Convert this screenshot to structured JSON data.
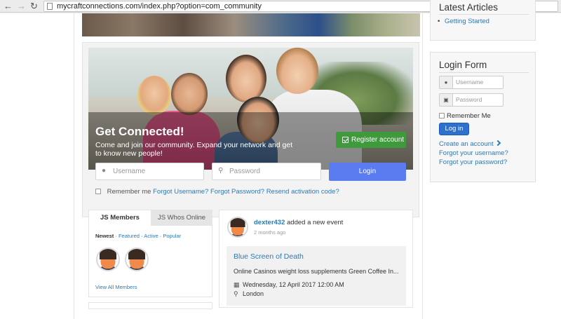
{
  "browser": {
    "url": "mycraftconnections.com/index.php?option=com_community",
    "back_glyph": "←",
    "forward_glyph": "→",
    "reload_glyph": "↻"
  },
  "hero": {
    "title": "Get Connected!",
    "text": "Come and join our community. Expand your network and get to know new people!",
    "register_label": "Register account"
  },
  "login_panel": {
    "username_placeholder": "Username",
    "password_placeholder": "Password",
    "login_label": "Login",
    "remember_label": "Remember me",
    "forgot_username": "Forgot Username?",
    "forgot_password": "Forgot Password?",
    "resend_activation": "Resend activation code?"
  },
  "members_module": {
    "tabs": [
      "JS Members",
      "JS Whos Online"
    ],
    "filters": {
      "newest": "Newest",
      "sep": " · ",
      "featured": "Featured",
      "active": "Active",
      "popular": "Popular"
    },
    "view_all": "View All Members"
  },
  "activity": {
    "user": "dexter432",
    "action": " added a new event",
    "time": "2 months ago",
    "event": {
      "title": "Blue Screen of Death",
      "description": "Online Casinos weight loss supplements Green Coffee In...",
      "date": "Wednesday, 12 April 2017 12:00 AM",
      "location": "London"
    }
  },
  "sidebar": {
    "latest_title": "Latest Articles",
    "latest_items": [
      "Getting Started"
    ],
    "login_form": {
      "title": "Login Form",
      "username_placeholder": "Username",
      "password_placeholder": "Password",
      "remember_label": "Remember Me",
      "login_label": "Log in",
      "create_account": "Create an account",
      "forgot_username": "Forgot your username?",
      "forgot_password": "Forgot your password?"
    }
  },
  "colors": {
    "accent_blue": "#5b7cf0",
    "register_green": "#3f9a3c",
    "link_blue": "#2a7ab8",
    "button_blue": "#2f6fcd"
  }
}
